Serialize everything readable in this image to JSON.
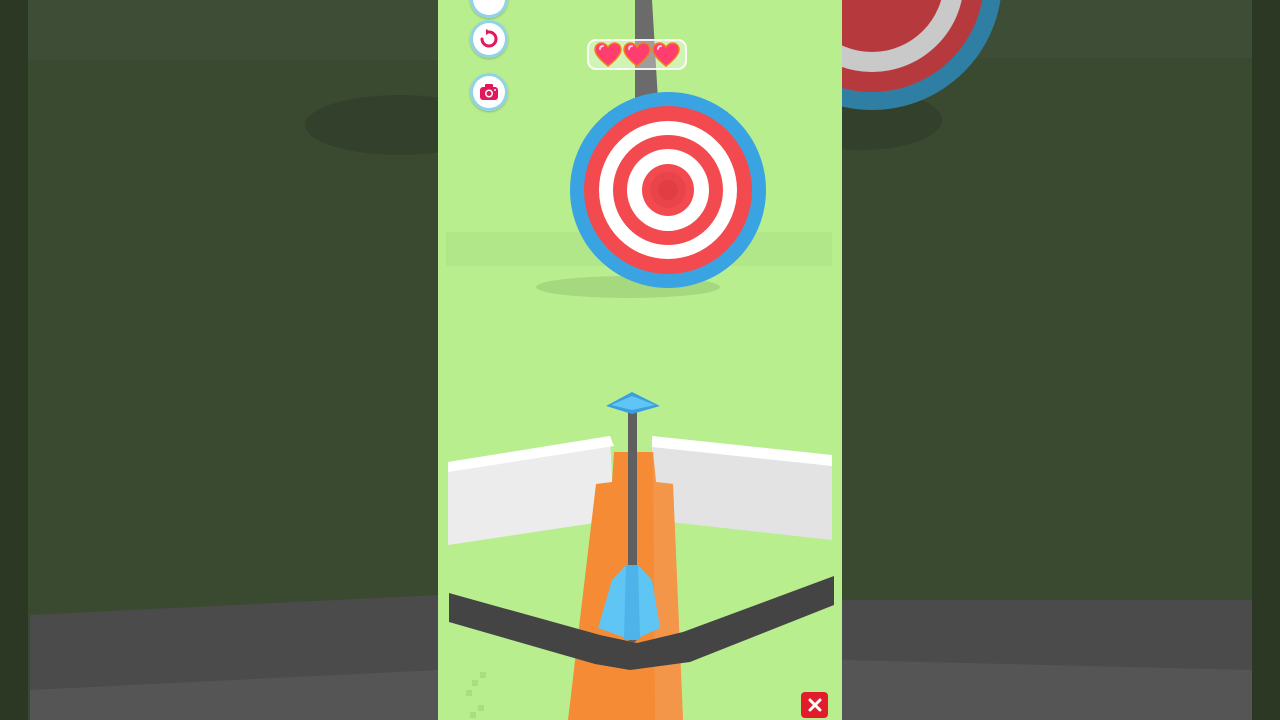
{
  "game": {
    "lives": {
      "current": 3,
      "max": 3
    },
    "buttons": [
      {
        "name": "restart-button",
        "icon": "restart-icon"
      },
      {
        "name": "camera-button",
        "icon": "camera-icon"
      }
    ],
    "close_icon": "close-icon"
  },
  "colors": {
    "background": "#b9ee8f",
    "target_red": "#f34a4f",
    "target_blue": "#3aa3e1",
    "bow_stock": "#f58b35",
    "bow_limb": "#444444",
    "arrow_fletching": "#5ec5f4",
    "heart": "#ff3d6e",
    "close_button": "#e11d2b"
  }
}
